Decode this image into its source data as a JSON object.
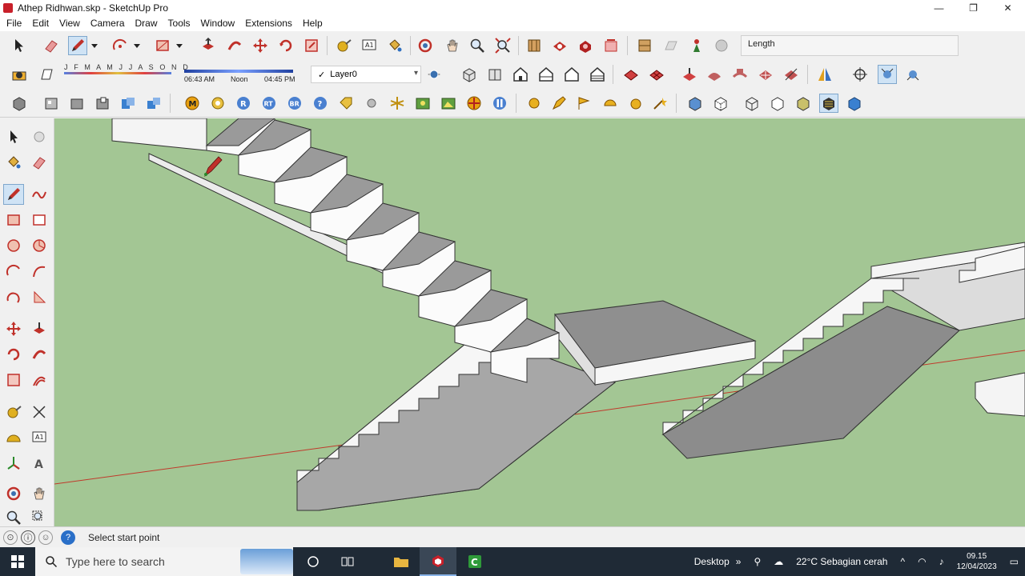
{
  "window": {
    "title": "Athep Ridhwan.skp - SketchUp Pro",
    "minimize_glyph": "—",
    "restore_glyph": "❐",
    "close_glyph": "✕"
  },
  "menu": [
    "File",
    "Edit",
    "View",
    "Camera",
    "Draw",
    "Tools",
    "Window",
    "Extensions",
    "Help"
  ],
  "measurements": {
    "label": "Length"
  },
  "shadow": {
    "months": "J F M A M J J A S O N D",
    "time_start": "06:43 AM",
    "time_mid": "Noon",
    "time_end": "04:45 PM"
  },
  "layer": {
    "current": "Layer0",
    "check": "✓"
  },
  "status": {
    "prompt": "Select start point"
  },
  "taskbar": {
    "search_placeholder": "Type here to search",
    "desktop_label": "Desktop",
    "desktop_chevron": "»",
    "weather": "22°C  Sebagian cerah",
    "tray_up": "^",
    "time": "09.15",
    "date": "12/04/2023"
  },
  "colors": {
    "viewport_bg": "#a3c694",
    "pencil_red": "#c0312a",
    "axis_red": "#c0392b"
  }
}
